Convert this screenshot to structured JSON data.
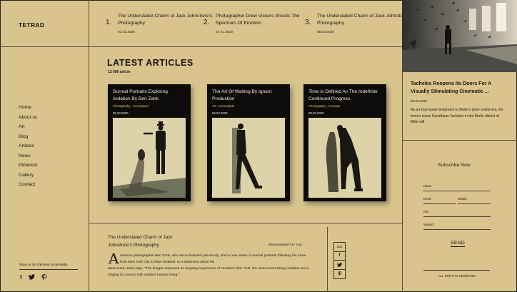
{
  "brand": {
    "logo": "TETRAD"
  },
  "top_articles": [
    {
      "num": "1.",
      "title": "The Understated Charm of Jack Johnstone's Photography",
      "date": "01.01.2020"
    },
    {
      "num": "2.",
      "title": "Photographer Drew Vickers Shoots The Spectrum Of Emotion",
      "date": "27.01.2020"
    },
    {
      "num": "3.",
      "title": "The Understated Charm of Jack Johnstone's Photography",
      "date": "08.03.2020"
    }
  ],
  "nav": {
    "items": [
      "Home",
      "About us",
      "Art",
      "Blog",
      "Articles",
      "News",
      "Pinterest",
      "Gallery",
      "Contact"
    ]
  },
  "social": {
    "label": "Share us On Following Social Media",
    "icons": [
      "facebook-icon",
      "twitter-icon",
      "pinterest-icon"
    ]
  },
  "latest": {
    "title": "LATEST ARTICLES",
    "count": "12 956 article",
    "cards": [
      {
        "title": "Surreal Portraits Exploring Isolation By Ben Zank",
        "category": "Photography ; Conceptual",
        "date": "08.03.2020"
      },
      {
        "title": "The Art Of Waiting By Ignant Production",
        "category": "Art ; Conceptual",
        "date": "08.03.2020"
      },
      {
        "title": "Time Is Defined As The Indefinite Continued Progress",
        "category": "Photography ; Concept",
        "date": "08.03.2020"
      }
    ]
  },
  "featured": {
    "title": "Tacheles Reopens Its Doors For A Visually Stimulating Cinematic ...",
    "date": "08.03.2020",
    "text": "As an impressive testament to Berlin's post- soviet era, the former iconic Kunsthaus Tacheles in the Berlin district of Mitte will"
  },
  "subscribe": {
    "title": "Subscribe Now",
    "name_label": "Name",
    "email_label": "Email",
    "mobile_label": "Mobile",
    "info_label": "Info",
    "subject_label": "Subject",
    "send_label": "SEND",
    "rights": "ALL RIGTHTS RESERVED"
  },
  "bottom_article": {
    "title": "The Understated Charm of Jack Johnstone's Photography",
    "recommended": "Recomended For You",
    "dropcap": "A",
    "text_first": "merican photographer Ben Zank, who we've featured previously, shot a new series of surreal portraits following his move from New York City to New Zealand. In a statement about his",
    "text_rest": "latest work, Zank says, \"The images represent an ongoing experience of emotions that I feel, the most recent being isolation and a longing to connect with another human being.\"",
    "share_count": "231",
    "share_icons": [
      "facebook-icon",
      "twitter-icon",
      "pinterest-icon"
    ]
  },
  "colors": {
    "background": "#d9c48e",
    "card": "#0d0c0a",
    "accent": "#e2c46b",
    "lines": "#5a4e34"
  }
}
